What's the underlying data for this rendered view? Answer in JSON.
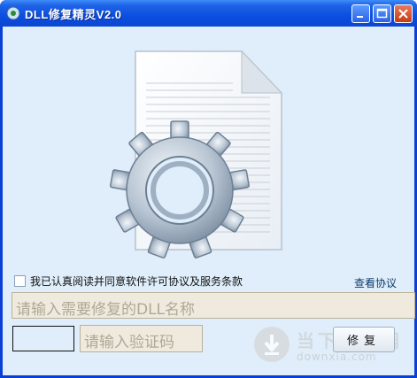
{
  "window": {
    "title": "DLL修复精灵V2.0",
    "icon": "app-gear-icon"
  },
  "form": {
    "agree_label": "我已认真阅读并同意软件许可协议及服务条款",
    "agree_checked": false,
    "view_agreement": "查看协议",
    "dll_placeholder": "请输入需要修复的DLL名称",
    "code_placeholder": "请输入验证码",
    "repair_label": "修复"
  },
  "watermark": {
    "brand": "当下软件园",
    "url": "downxia.com"
  },
  "colors": {
    "titlebar": "#0c4ee0",
    "client_bg": "#dfeefa",
    "input_bg": "#efeadd"
  }
}
